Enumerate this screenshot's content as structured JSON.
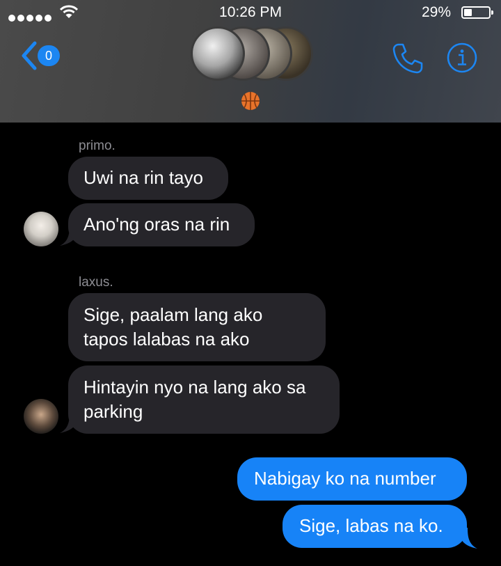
{
  "status": {
    "time": "10:26 PM",
    "battery": "29%",
    "signal_dots": 5,
    "battery_level": 0.29
  },
  "header": {
    "unread_count": "0",
    "group_emoji": "🏀",
    "icons": [
      "chevron-left-icon",
      "phone-icon",
      "info-icon",
      "basketball-icon"
    ]
  },
  "messages": [
    {
      "sender": "primo.",
      "direction": "incoming",
      "text": "Uwi na rin tayo"
    },
    {
      "sender": "primo.",
      "direction": "incoming",
      "text": "Ano'ng oras na rin"
    },
    {
      "sender": "laxus.",
      "direction": "incoming",
      "text": "Sige, paalam lang ako tapos lalabas na ako"
    },
    {
      "sender": "laxus.",
      "direction": "incoming",
      "text": "Hintayin nyo na lang ako sa parking"
    },
    {
      "sender": "",
      "direction": "outgoing",
      "text": "Nabigay ko na number"
    },
    {
      "sender": "",
      "direction": "outgoing",
      "text": "Sige, labas na ko."
    }
  ],
  "colors": {
    "accent": "#1783f7",
    "incoming_bubble": "#26252a",
    "sender_label": "#8d8d93",
    "background": "#000000"
  }
}
